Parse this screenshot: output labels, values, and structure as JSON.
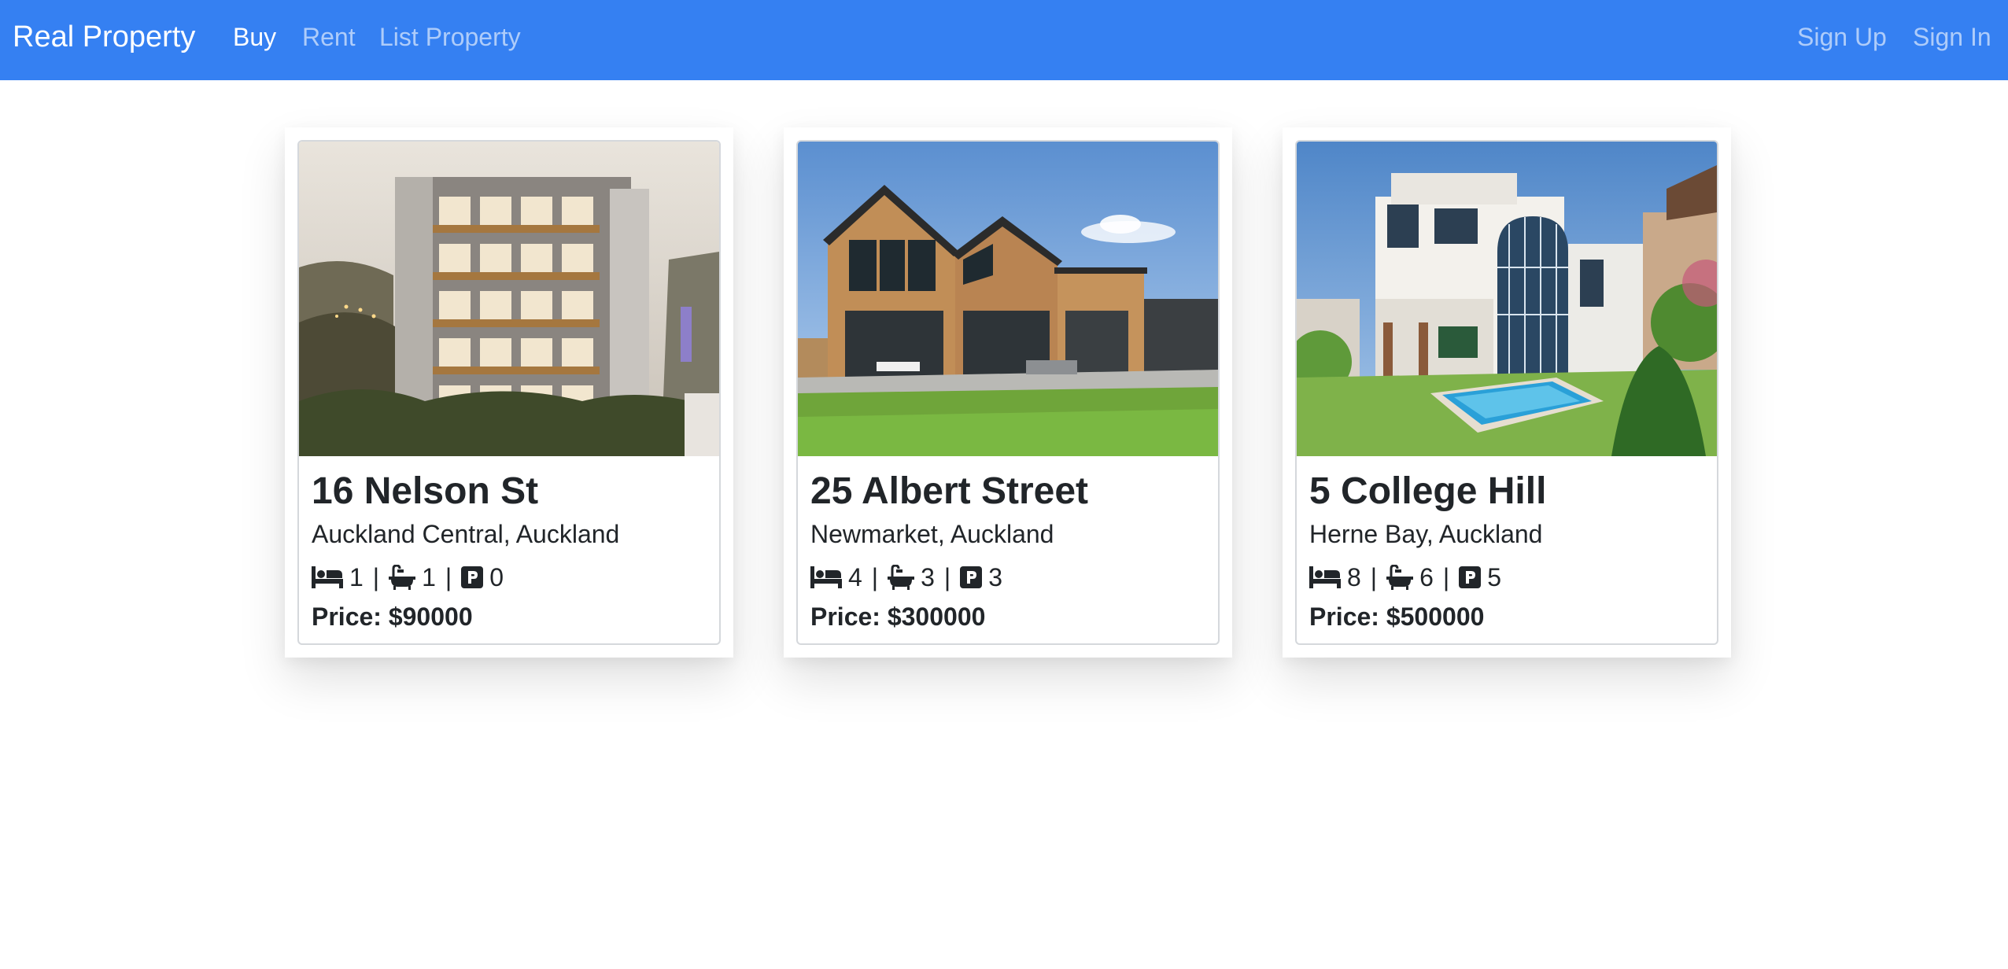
{
  "nav": {
    "brand": "Real Property",
    "links": [
      {
        "label": "Buy",
        "active": true
      },
      {
        "label": "Rent",
        "active": false
      },
      {
        "label": "List Property",
        "active": false
      }
    ],
    "auth": [
      {
        "label": "Sign Up"
      },
      {
        "label": "Sign In"
      }
    ],
    "bar_color": "#3580f2"
  },
  "listings": [
    {
      "title": "16 Nelson St",
      "location": "Auckland Central, Auckland",
      "beds": "1",
      "baths": "1",
      "parking": "0",
      "price": "Price: $90000"
    },
    {
      "title": "25 Albert Street",
      "location": "Newmarket, Auckland",
      "beds": "4",
      "baths": "3",
      "parking": "3",
      "price": "Price: $300000"
    },
    {
      "title": "5 College Hill",
      "location": "Herne Bay, Auckland",
      "beds": "8",
      "baths": "6",
      "parking": "5",
      "price": "Price: $500000"
    }
  ],
  "icons": {
    "beds": "bed-icon",
    "baths": "bath-icon",
    "parking": "parking-icon"
  }
}
